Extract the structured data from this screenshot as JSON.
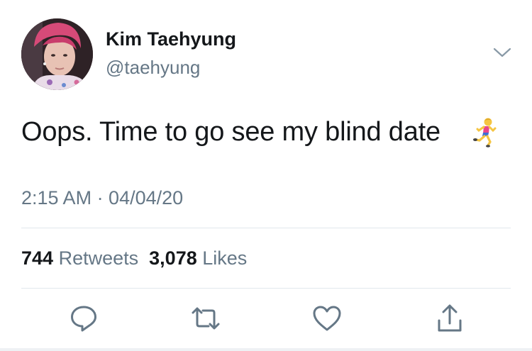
{
  "tweet": {
    "author": {
      "display_name": "Kim Taehyung",
      "handle": "@taehyung"
    },
    "text": "Oops. Time to go see my blind date",
    "emoji": "man-running-emoji",
    "timestamp": "2:15 AM · 04/04/20",
    "stats": {
      "retweets_count": "744",
      "retweets_label": "Retweets",
      "likes_count": "3,078",
      "likes_label": "Likes"
    }
  },
  "actions": [
    {
      "name": "reply",
      "icon": "reply-icon"
    },
    {
      "name": "retweet",
      "icon": "retweet-icon"
    },
    {
      "name": "like",
      "icon": "heart-icon"
    },
    {
      "name": "share",
      "icon": "share-icon"
    }
  ],
  "colors": {
    "text_primary": "#14171a",
    "text_secondary": "#657786",
    "divider": "#e1e8ed",
    "icon": "#657786"
  }
}
